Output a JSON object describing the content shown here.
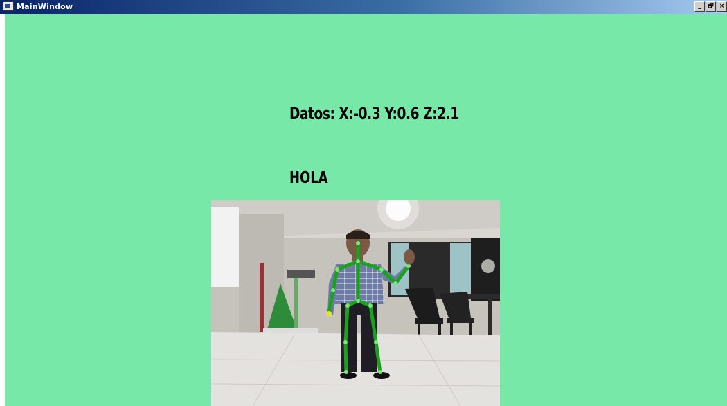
{
  "window": {
    "title": "MainWindow"
  },
  "titlebar_buttons": {
    "minimize": "_",
    "maximize": "🗗",
    "close": "×"
  },
  "readout": {
    "text": "Datos: X:-0.3 Y:0.6 Z:2.1"
  },
  "gesture": {
    "text": "HOLA"
  },
  "colors": {
    "background": "#78e8a8",
    "skeleton": "#1aa31a"
  },
  "camera_feed": {
    "description_icon": "camera-feed-icon"
  }
}
